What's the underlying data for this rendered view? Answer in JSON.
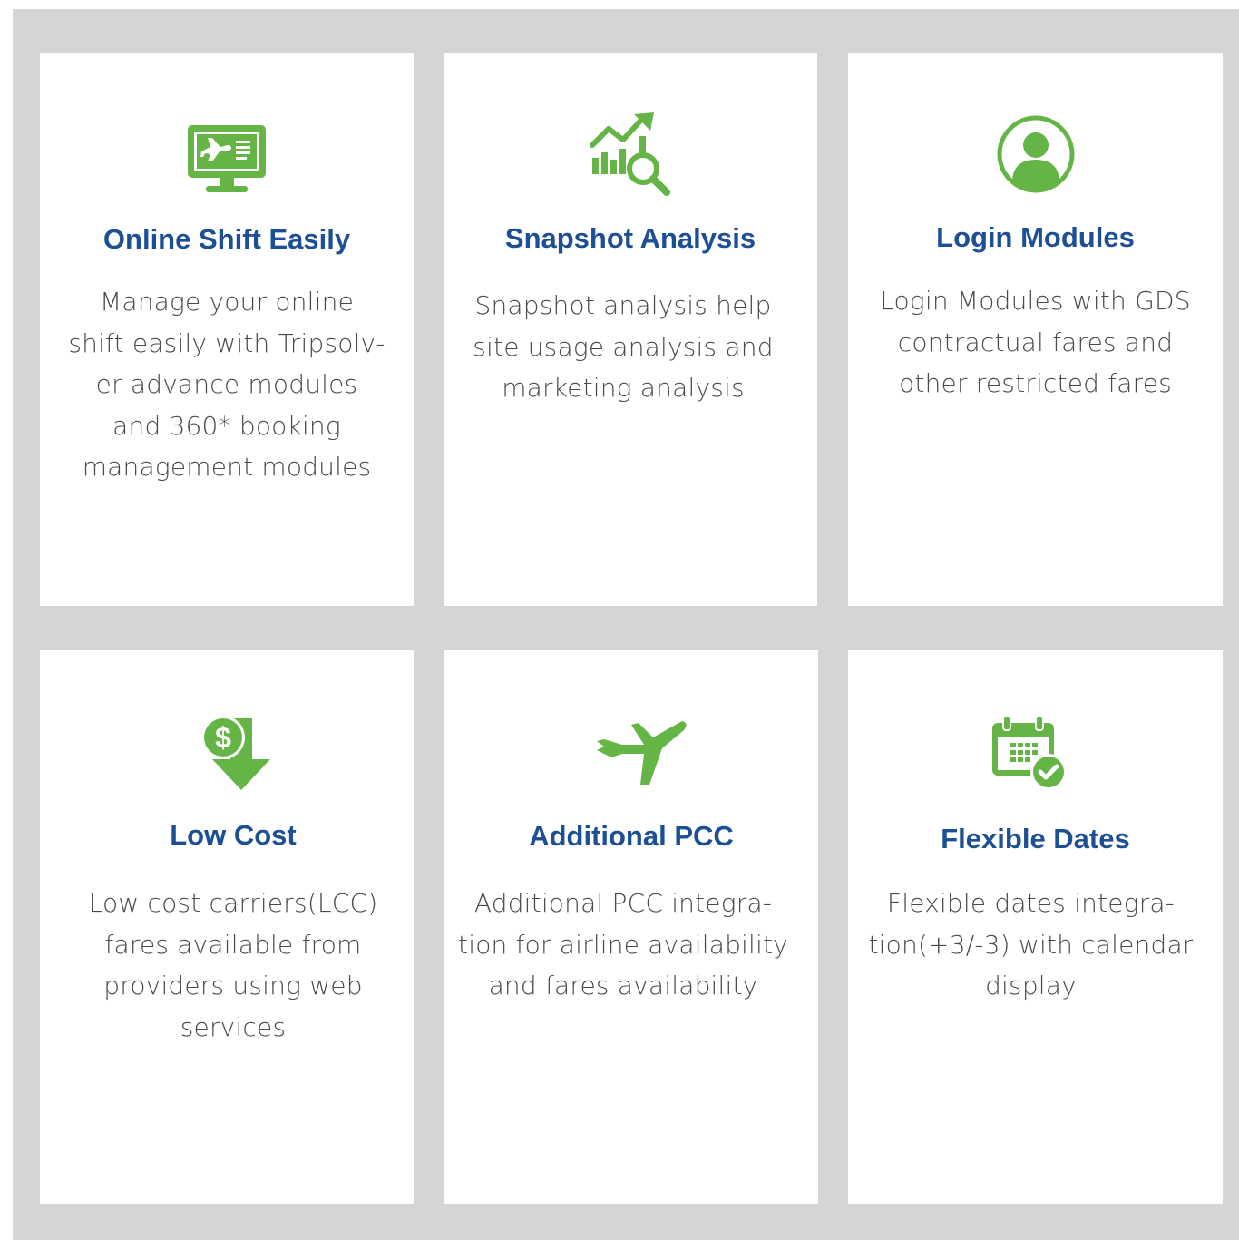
{
  "colors": {
    "panel": "#d5d5d5",
    "title": "#1c4f96",
    "text": "#4a4a4a",
    "icon": "#64b446"
  },
  "features": [
    {
      "icon": "monitor-plane-icon",
      "title": "Online Shift Easily",
      "lines": [
        "Manage your online",
        "shift easily with Tripsolv-",
        "er advance modules",
        "and 360* booking",
        "management modules"
      ]
    },
    {
      "icon": "chart-analysis-icon",
      "title": "Snapshot Analysis",
      "lines": [
        "Snapshot analysis help",
        "site usage analysis and",
        "marketing analysis"
      ]
    },
    {
      "icon": "user-circle-icon",
      "title": "Login Modules",
      "lines": [
        "Login Modules with GDS",
        "contractual fares and",
        "other restricted fares"
      ]
    },
    {
      "icon": "dollar-down-icon",
      "title": "Low Cost",
      "lines": [
        "Low cost carriers(LCC)",
        "fares available from",
        "providers using web",
        "services"
      ]
    },
    {
      "icon": "airplane-icon",
      "title": "Additional PCC",
      "lines": [
        "Additional PCC integra-",
        "tion for airline availability",
        "and fares availability"
      ]
    },
    {
      "icon": "calendar-check-icon",
      "title": "Flexible Dates",
      "lines": [
        "Flexible dates integra-",
        "tion(+3/-3) with calendar",
        "display"
      ]
    }
  ]
}
